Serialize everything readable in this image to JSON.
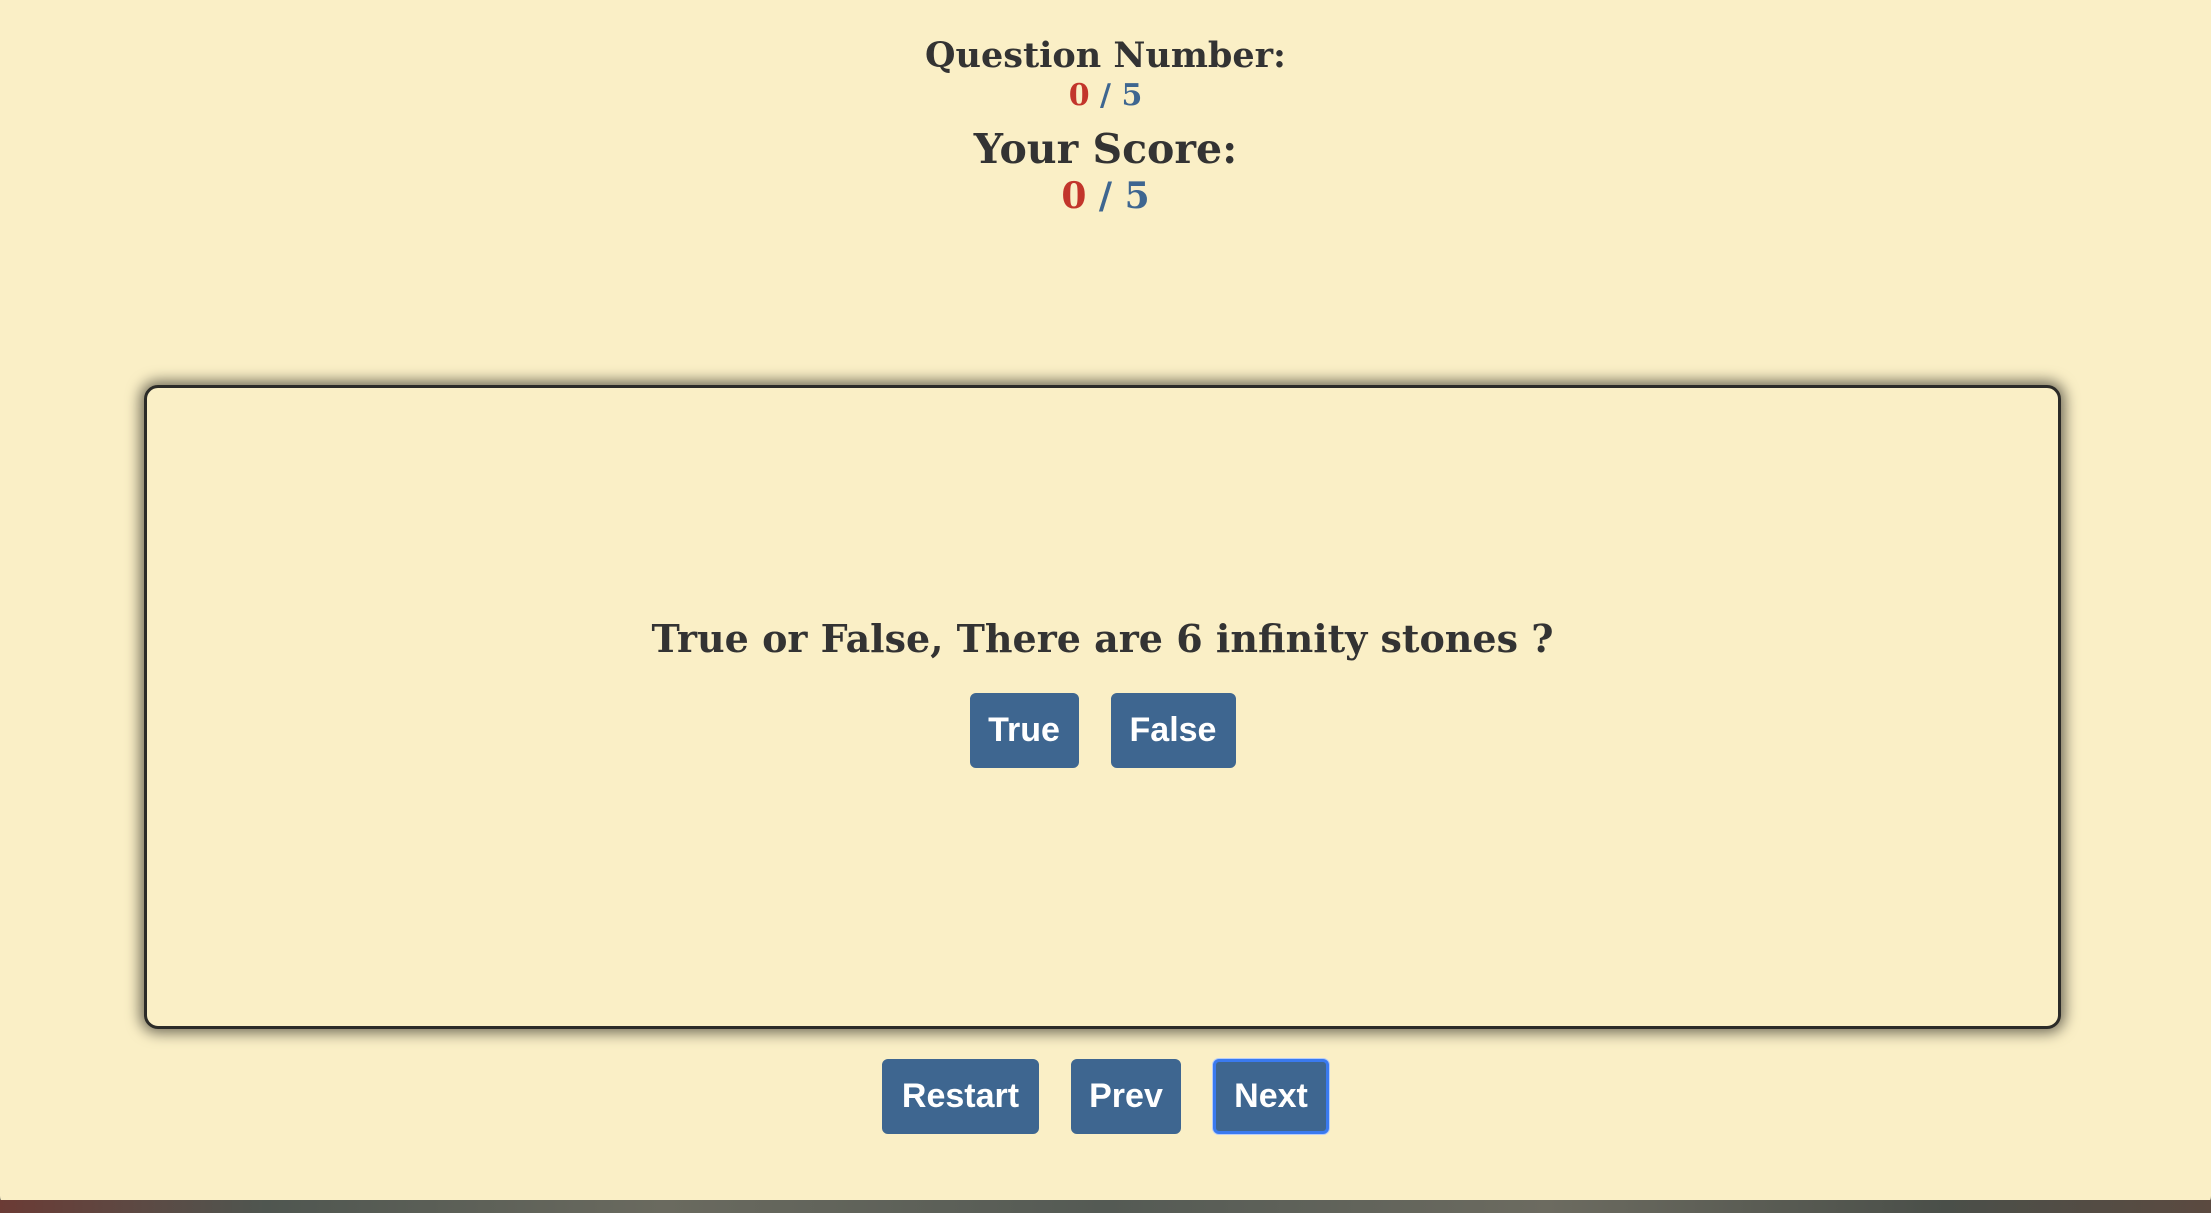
{
  "header": {
    "question_label": "Question Number:",
    "question_current": "0",
    "question_separator": "/",
    "question_total": "5",
    "score_label": "Your Score:",
    "score_current": "0",
    "score_separator": "/",
    "score_total": "5"
  },
  "question": {
    "text": "True or False, There are 6 infinity stones ?",
    "answers": [
      "True",
      "False"
    ]
  },
  "navigation": {
    "restart_label": "Restart",
    "prev_label": "Prev",
    "next_label": "Next"
  },
  "colors": {
    "background": "#faefc6",
    "text": "#333333",
    "button": "#3e6690",
    "current_number": "#c2352b",
    "focus_outline": "#3a7af0"
  }
}
